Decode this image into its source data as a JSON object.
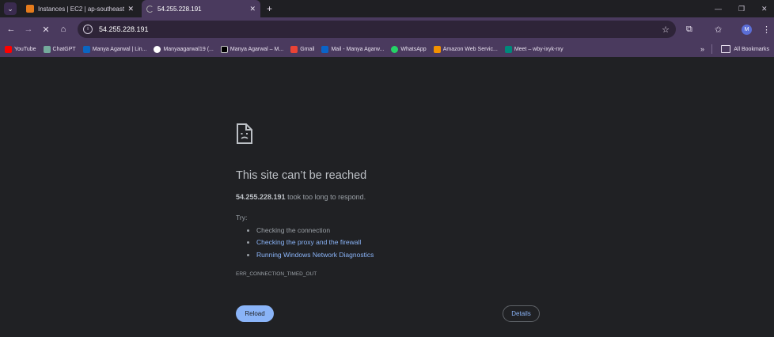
{
  "tabs": [
    {
      "title": "Instances | EC2 | ap-southeast",
      "state": "inactive"
    },
    {
      "title": "54.255.228.191",
      "state": "loading"
    }
  ],
  "address_bar": {
    "url": "54.255.228.191"
  },
  "bookmarks": [
    {
      "label": "YouTube",
      "icon": "youtube-icon",
      "color": "#ff0000"
    },
    {
      "label": "ChatGPT",
      "icon": "chatgpt-icon",
      "color": "#74aa9c"
    },
    {
      "label": "Manya Agarwal | Lin...",
      "icon": "linkedin-icon",
      "color": "#0a66c2"
    },
    {
      "label": "Manyaagarwal19 (...",
      "icon": "github-icon",
      "color": "#ffffff"
    },
    {
      "label": "Manya Agarwal – M...",
      "icon": "medium-icon",
      "color": "#000000"
    },
    {
      "label": "Gmail",
      "icon": "gmail-icon",
      "color": "#ea4335"
    },
    {
      "label": "Mail - Manya Agarw...",
      "icon": "outlook-icon",
      "color": "#0a64c8"
    },
    {
      "label": "WhatsApp",
      "icon": "whatsapp-icon",
      "color": "#25d366"
    },
    {
      "label": "Amazon Web Servic...",
      "icon": "aws-icon",
      "color": "#f29100"
    },
    {
      "label": "Meet – wby-ixyk-rxy",
      "icon": "meet-icon",
      "color": "#00897b"
    }
  ],
  "bookmarks_more": "»",
  "all_bookmarks": "All Bookmarks",
  "profile_initial": "M",
  "error": {
    "heading": "This site can’t be reached",
    "host": "54.255.228.191",
    "summary_rest": " took too long to respond.",
    "try_label": "Try:",
    "suggestions": [
      {
        "text": "Checking the connection",
        "link": false
      },
      {
        "text": "Checking the proxy and the firewall",
        "link": true
      },
      {
        "text": "Running Windows Network Diagnostics",
        "link": true
      }
    ],
    "code": "ERR_CONNECTION_TIMED_OUT",
    "reload_label": "Reload",
    "details_label": "Details"
  },
  "colors": {
    "accent": "#8ab4f8",
    "toolbar": "#4a3a5e",
    "background": "#202124"
  }
}
